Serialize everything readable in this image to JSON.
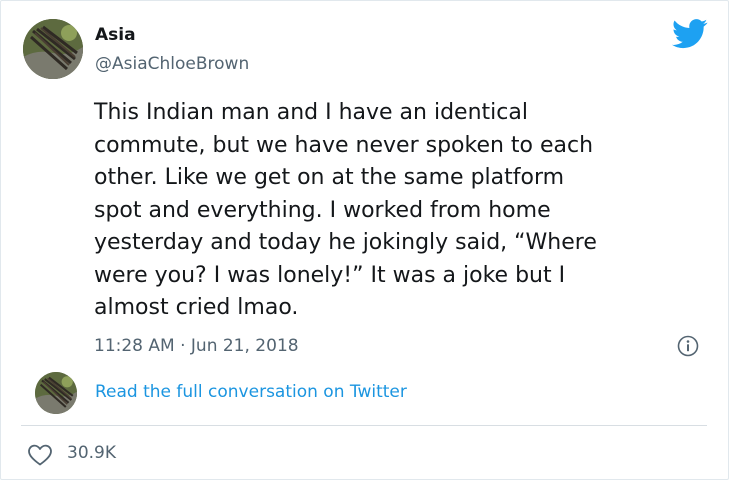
{
  "user": {
    "display_name": "Asia",
    "handle": "@AsiaChloeBrown"
  },
  "tweet": {
    "lines": [
      "This Indian man and I have an identical",
      "commute, but we have never spoken to each",
      "other. Like we get on at the same platform",
      "spot and everything. I worked from home",
      "yesterday and today he jokingly said, “Where",
      "were you? I was lonely!” It was a joke but I",
      "almost cried lmao."
    ],
    "timestamp": "11:28 AM · Jun 21, 2018"
  },
  "conversation_link": "Read the full conversation on Twitter",
  "likes": "30.9K",
  "icons": {
    "brand": "twitter-bird-icon",
    "info": "info-icon",
    "like": "heart-icon"
  },
  "colors": {
    "brand_blue": "#1da1f2",
    "link_blue": "#1b95e0",
    "secondary_text": "#536471",
    "divider": "#d8dee3"
  }
}
